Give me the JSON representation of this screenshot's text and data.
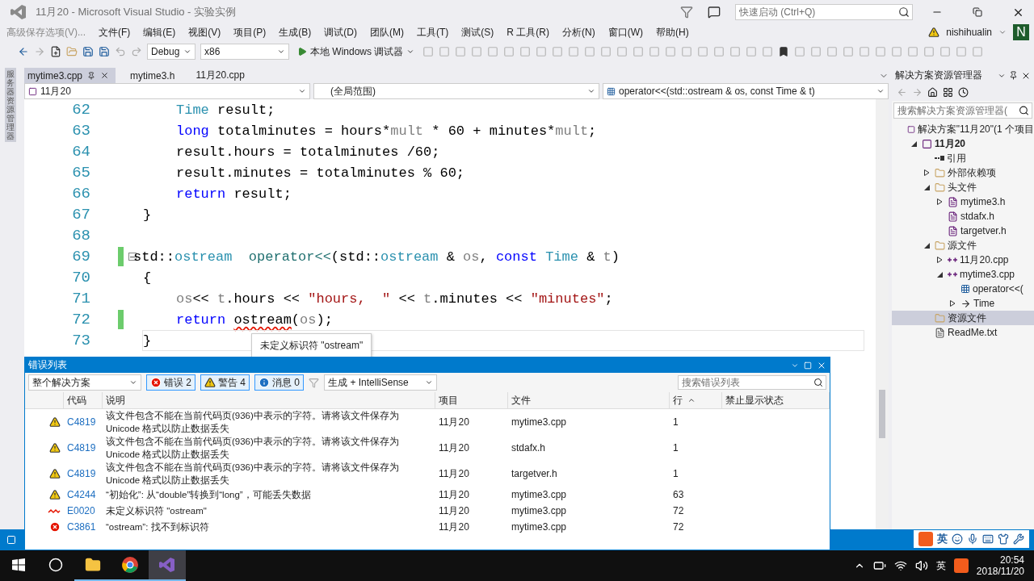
{
  "window": {
    "title": "11月20 - Microsoft Visual Studio  - 实验实例",
    "quick_launch": {
      "placeholder": "快速启动 (Ctrl+Q)"
    }
  },
  "menu": {
    "save_options": "高级保存选项(V)...",
    "items": [
      "文件(F)",
      "编辑(E)",
      "视图(V)",
      "项目(P)",
      "生成(B)",
      "调试(D)",
      "团队(M)",
      "工具(T)",
      "测试(S)",
      "R 工具(R)",
      "分析(N)",
      "窗口(W)",
      "帮助(H)"
    ],
    "user": "nishihualin",
    "avatar": "N"
  },
  "toolbar": {
    "configuration": "Debug",
    "platform": "x86",
    "run": "本地 Windows 调试器"
  },
  "left_strip": {
    "label": "服务器资源管理器"
  },
  "doc_tabs": [
    {
      "label": "mytime3.cpp",
      "selected": true
    },
    {
      "label": "mytime3.h",
      "selected": false
    },
    {
      "label": "11月20.cpp",
      "selected": false
    }
  ],
  "nav": {
    "project": "11月20",
    "scope": "(全局范围)",
    "member": "operator<<(std::ostream & os, const Time & t)"
  },
  "code": {
    "lines": [
      {
        "number": "62",
        "indented": true,
        "changed": false,
        "fold": false,
        "current": false,
        "tokens": [
          {
            "kind": "type",
            "text": "Time"
          },
          {
            "kind": "text",
            "text": " result;"
          }
        ]
      },
      {
        "number": "63",
        "indented": true,
        "changed": false,
        "fold": false,
        "current": false,
        "tokens": [
          {
            "kind": "keyword",
            "text": "long"
          },
          {
            "kind": "text",
            "text": " totalminutes = hours*"
          },
          {
            "kind": "param",
            "text": "mult"
          },
          {
            "kind": "text",
            "text": " * 60 + minutes*"
          },
          {
            "kind": "param",
            "text": "mult"
          },
          {
            "kind": "text",
            "text": ";"
          }
        ]
      },
      {
        "number": "64",
        "indented": true,
        "changed": false,
        "fold": false,
        "current": false,
        "tokens": [
          {
            "kind": "text",
            "text": "result.hours = totalminutes /60;"
          }
        ]
      },
      {
        "number": "65",
        "indented": true,
        "changed": false,
        "fold": false,
        "current": false,
        "tokens": [
          {
            "kind": "text",
            "text": "result.minutes = totalminutes % 60;"
          }
        ]
      },
      {
        "number": "66",
        "indented": true,
        "changed": false,
        "fold": false,
        "current": false,
        "tokens": [
          {
            "kind": "keyword",
            "text": "return"
          },
          {
            "kind": "text",
            "text": " result;"
          }
        ]
      },
      {
        "number": "67",
        "indented": false,
        "changed": false,
        "fold": false,
        "current": false,
        "tokens": [
          {
            "kind": "text",
            "text": "}"
          }
        ]
      },
      {
        "number": "68",
        "changed": false,
        "fold": false,
        "current": false
      },
      {
        "number": "69",
        "indented": false,
        "changed": true,
        "fold": true,
        "current": false,
        "tokens": [
          {
            "kind": "text",
            "text": "std::"
          },
          {
            "kind": "type",
            "text": "ostream"
          },
          {
            "kind": "function",
            "text": "  operator<<"
          },
          {
            "kind": "text",
            "text": "(std::"
          },
          {
            "kind": "type",
            "text": "ostream"
          },
          {
            "kind": "text",
            "text": " & "
          },
          {
            "kind": "param",
            "text": "os"
          },
          {
            "kind": "text",
            "text": ", "
          },
          {
            "kind": "keyword",
            "text": "const"
          },
          {
            "kind": "type",
            "text": " Time"
          },
          {
            "kind": "text",
            "text": " & "
          },
          {
            "kind": "param",
            "text": "t"
          },
          {
            "kind": "text",
            "text": ")"
          }
        ]
      },
      {
        "number": "70",
        "indented": false,
        "changed": false,
        "fold": false,
        "current": false,
        "tokens": [
          {
            "kind": "text",
            "text": "{"
          }
        ]
      },
      {
        "number": "71",
        "indented": true,
        "changed": false,
        "fold": false,
        "current": false,
        "tokens": [
          {
            "kind": "param",
            "text": "os"
          },
          {
            "kind": "text",
            "text": "<< "
          },
          {
            "kind": "param",
            "text": "t"
          },
          {
            "kind": "text",
            "text": ".hours << "
          },
          {
            "kind": "string",
            "text": "\"hours,  \""
          },
          {
            "kind": "text",
            "text": " << "
          },
          {
            "kind": "param",
            "text": "t"
          },
          {
            "kind": "text",
            "text": ".minutes << "
          },
          {
            "kind": "string",
            "text": "\"minutes\""
          },
          {
            "kind": "text",
            "text": ";"
          }
        ]
      },
      {
        "number": "72",
        "indented": true,
        "changed": true,
        "fold": false,
        "current": false,
        "tokens": [
          {
            "kind": "keyword",
            "text": "return "
          },
          {
            "kind": "error",
            "text": "ostream"
          },
          {
            "kind": "text",
            "text": "("
          },
          {
            "kind": "param",
            "text": "os"
          },
          {
            "kind": "text",
            "text": ");"
          }
        ]
      },
      {
        "number": "73",
        "indented": false,
        "changed": false,
        "fold": false,
        "current": true,
        "tokens": [
          {
            "kind": "text",
            "text": "}"
          }
        ]
      }
    ],
    "tooltip": "未定义标识符 \"ostream\""
  },
  "error_list": {
    "title": "错误列表",
    "scope": "整个解决方案",
    "filters": [
      {
        "kind": "error",
        "label": "错误 2",
        "selected": true
      },
      {
        "kind": "warning",
        "label": "警告 4",
        "selected": true
      },
      {
        "kind": "info",
        "label": "消息 0",
        "selected": true
      }
    ],
    "source": "生成 + IntelliSense",
    "search": {
      "placeholder": "搜索错误列表"
    },
    "columns": [
      "代码",
      "说明",
      "项目",
      "文件",
      "行",
      "禁止显示状态"
    ],
    "rows": [
      {
        "kind": "warning",
        "code": "C4819",
        "description": "该文件包含不能在当前代码页(936)中表示的字符。请将该文件保存为 Unicode 格式以防止数据丢失",
        "project": "11月20",
        "file": "mytime3.cpp",
        "line": "1"
      },
      {
        "kind": "warning",
        "code": "C4819",
        "description": "该文件包含不能在当前代码页(936)中表示的字符。请将该文件保存为 Unicode 格式以防止数据丢失",
        "project": "11月20",
        "file": "stdafx.h",
        "line": "1"
      },
      {
        "kind": "warning",
        "code": "C4819",
        "description": "该文件包含不能在当前代码页(936)中表示的字符。请将该文件保存为 Unicode 格式以防止数据丢失",
        "project": "11月20",
        "file": "targetver.h",
        "line": "1"
      },
      {
        "kind": "warning",
        "code": "C4244",
        "description": "“初始化”: 从“double”转换到“long”，可能丢失数据",
        "project": "11月20",
        "file": "mytime3.cpp",
        "line": "63"
      },
      {
        "kind": "squiggle",
        "code": "E0020",
        "description": "未定义标识符 \"ostream\"",
        "project": "11月20",
        "file": "mytime3.cpp",
        "line": "72"
      },
      {
        "kind": "error",
        "code": "C3861",
        "description": "“ostream”: 找不到标识符",
        "project": "11月20",
        "file": "mytime3.cpp",
        "line": "72"
      }
    ]
  },
  "solution_explorer": {
    "title": "解决方案资源管理器",
    "search": {
      "placeholder": "搜索解决方案资源管理器("
    },
    "tree": [
      {
        "kind": "solution",
        "label": "解决方案\"11月20\"(1 个项目",
        "selected": false,
        "children": [
          {
            "kind": "project",
            "label": "11月20",
            "expanded": true,
            "selected": false,
            "children": [
              {
                "kind": "references",
                "label": "引用",
                "selected": false
              },
              {
                "kind": "external",
                "label": "外部依赖项",
                "expanded": false,
                "selected": false
              },
              {
                "kind": "folder",
                "label": "头文件",
                "expanded": true,
                "selected": false,
                "children": [
                  {
                    "kind": "header",
                    "label": "mytime3.h",
                    "expanded": false,
                    "selected": false
                  },
                  {
                    "kind": "header",
                    "label": "stdafx.h",
                    "selected": false
                  },
                  {
                    "kind": "header",
                    "label": "targetver.h",
                    "selected": false
                  }
                ]
              },
              {
                "kind": "folder",
                "label": "源文件",
                "expanded": true,
                "selected": false,
                "children": [
                  {
                    "kind": "cpp",
                    "label": "11月20.cpp",
                    "expanded": false,
                    "selected": false
                  },
                  {
                    "kind": "cpp",
                    "label": "mytime3.cpp",
                    "expanded": true,
                    "selected": false,
                    "children": [
                      {
                        "kind": "member",
                        "label": "operator<<(",
                        "selected": false
                      },
                      {
                        "kind": "class",
                        "label": "Time",
                        "expanded": false,
                        "selected": false
                      }
                    ]
                  }
                ]
              },
              {
                "kind": "folder",
                "label": "资源文件",
                "selected": true
              },
              {
                "kind": "file",
                "label": "ReadMe.txt",
                "selected": false
              }
            ]
          }
        ]
      }
    ]
  },
  "ime": {
    "label": "英"
  },
  "taskbar": {
    "apps": [
      {
        "kind": "search",
        "active": false,
        "running": false
      },
      {
        "kind": "explorer",
        "active": false,
        "running": true
      },
      {
        "kind": "chrome",
        "active": false,
        "running": true
      },
      {
        "kind": "studio",
        "active": true,
        "running": true
      }
    ],
    "tray": {
      "language": "英",
      "time": "20:54",
      "date": "2018/11/20"
    }
  }
}
